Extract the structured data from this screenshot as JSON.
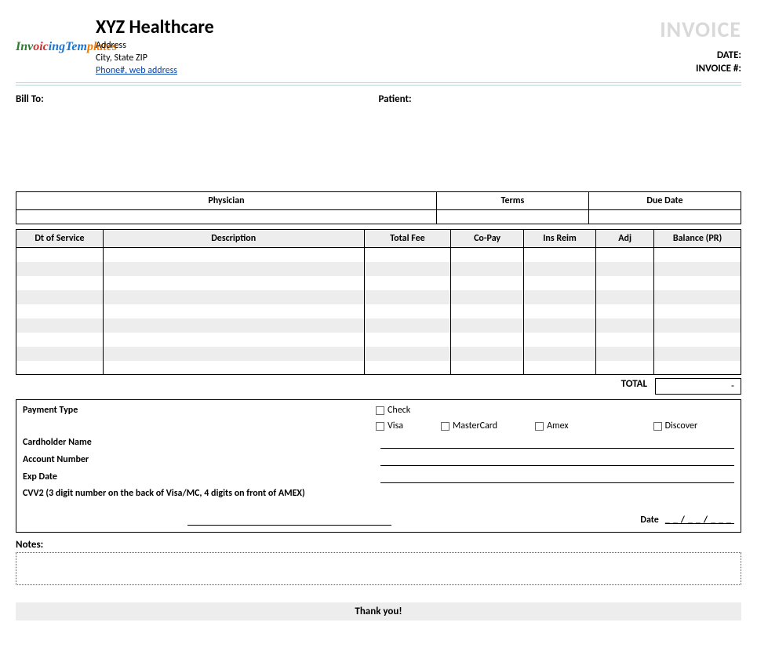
{
  "header": {
    "logo_text": "InvoicingTemplates",
    "company_name": "XYZ Healthcare",
    "address_line1": "Address",
    "address_line2": "City, State ZIP",
    "contact_link": "Phone#, web address",
    "invoice_title": "INVOICE",
    "date_label": "DATE:",
    "invoice_num_label": "INVOICE #:",
    "date_value": "",
    "invoice_num_value": ""
  },
  "parties": {
    "bill_to_label": "Bill To:",
    "patient_label": "Patient:",
    "bill_to_value": "",
    "patient_value": ""
  },
  "summary": {
    "headers": [
      "Physician",
      "Terms",
      "Due Date"
    ],
    "values": [
      "",
      "",
      ""
    ]
  },
  "items": {
    "headers": {
      "dt": "Dt of Service",
      "desc": "Description",
      "fee": "Total Fee",
      "copay": "Co-Pay",
      "ins": "Ins Reim",
      "adj": "Adj",
      "bal": "Balance (PR)"
    },
    "rows": [
      {
        "dt": "",
        "desc": "",
        "fee": "",
        "copay": "",
        "ins": "",
        "adj": "",
        "bal": ""
      },
      {
        "dt": "",
        "desc": "",
        "fee": "",
        "copay": "",
        "ins": "",
        "adj": "",
        "bal": ""
      },
      {
        "dt": "",
        "desc": "",
        "fee": "",
        "copay": "",
        "ins": "",
        "adj": "",
        "bal": ""
      },
      {
        "dt": "",
        "desc": "",
        "fee": "",
        "copay": "",
        "ins": "",
        "adj": "",
        "bal": ""
      },
      {
        "dt": "",
        "desc": "",
        "fee": "",
        "copay": "",
        "ins": "",
        "adj": "",
        "bal": ""
      },
      {
        "dt": "",
        "desc": "",
        "fee": "",
        "copay": "",
        "ins": "",
        "adj": "",
        "bal": ""
      },
      {
        "dt": "",
        "desc": "",
        "fee": "",
        "copay": "",
        "ins": "",
        "adj": "",
        "bal": ""
      },
      {
        "dt": "",
        "desc": "",
        "fee": "",
        "copay": "",
        "ins": "",
        "adj": "",
        "bal": ""
      },
      {
        "dt": "",
        "desc": "",
        "fee": "",
        "copay": "",
        "ins": "",
        "adj": "",
        "bal": ""
      }
    ],
    "total_label": "TOTAL",
    "total_value": "-"
  },
  "payment": {
    "type_label": "Payment Type",
    "options": [
      "Check",
      "Visa",
      "MasterCard",
      "Amex",
      "Discover"
    ],
    "cardholder_label": "Cardholder Name",
    "account_label": "Account Number",
    "exp_label": "Exp Date",
    "cvv_label": "CVV2 (3 digit number on the back of Visa/MC, 4 digits on front of AMEX)",
    "date_label": "Date",
    "date_placeholder": "__/__/___"
  },
  "notes_label": "Notes:",
  "footer": "Thank you!"
}
